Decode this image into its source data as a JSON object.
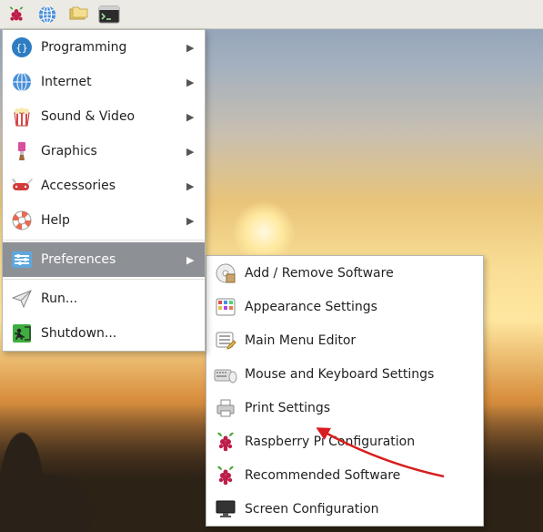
{
  "panel": {
    "items": [
      "raspberry-menu",
      "web-browser",
      "file-manager",
      "terminal"
    ]
  },
  "menu": {
    "items": [
      {
        "id": "programming",
        "label": "Programming",
        "submenu": true,
        "selected": false
      },
      {
        "id": "internet",
        "label": "Internet",
        "submenu": true,
        "selected": false
      },
      {
        "id": "soundvideo",
        "label": "Sound & Video",
        "submenu": true,
        "selected": false
      },
      {
        "id": "graphics",
        "label": "Graphics",
        "submenu": true,
        "selected": false
      },
      {
        "id": "accessories",
        "label": "Accessories",
        "submenu": true,
        "selected": false
      },
      {
        "id": "help",
        "label": "Help",
        "submenu": true,
        "selected": false
      },
      {
        "id": "preferences",
        "label": "Preferences",
        "submenu": true,
        "selected": true
      },
      {
        "id": "run",
        "label": "Run...",
        "submenu": false,
        "selected": false
      },
      {
        "id": "shutdown",
        "label": "Shutdown...",
        "submenu": false,
        "selected": false
      }
    ]
  },
  "submenu": {
    "parent": "preferences",
    "items": [
      {
        "id": "addremove",
        "label": "Add / Remove Software"
      },
      {
        "id": "appearance",
        "label": "Appearance Settings"
      },
      {
        "id": "mainmenu",
        "label": "Main Menu Editor"
      },
      {
        "id": "mousekb",
        "label": "Mouse and Keyboard Settings"
      },
      {
        "id": "print",
        "label": "Print Settings"
      },
      {
        "id": "rpiconfig",
        "label": "Raspberry Pi Configuration"
      },
      {
        "id": "recommended",
        "label": "Recommended Software"
      },
      {
        "id": "screenconfig",
        "label": "Screen Configuration"
      }
    ]
  }
}
